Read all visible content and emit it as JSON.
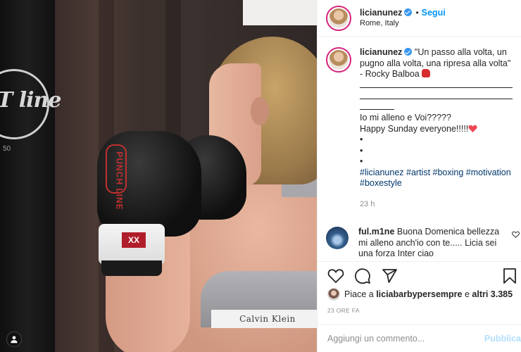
{
  "header": {
    "username": "licianunez",
    "separator": "•",
    "follow_label": "Segui",
    "location": "Rome, Italy"
  },
  "caption": {
    "username": "licianunez",
    "line1": "\"Un passo alla volta, un pugno alla volta, una ripresa alla volta\"",
    "line2": "- Rocky Balboa",
    "line3": "Io mi alleno e Voi?????",
    "line4": "Happy Sunday everyone!!!!!",
    "bullets": [
      "•",
      "•",
      "•"
    ],
    "hashtags": "#licianunez #artist #boxing #motivation #boxestyle",
    "time": "23 h"
  },
  "comment": {
    "username": "ful.m1ne",
    "text": "Buona Domenica bellezza mi alleno anch'io con te..... Licia sei una forza Inter ciao"
  },
  "likes": {
    "prefix": "Piace a",
    "user": "liciabarbypersempre",
    "middle": "e",
    "others": "altri 3.385"
  },
  "post_time": "23 ORE FA",
  "add_comment": {
    "placeholder": "Aggiungi un commento...",
    "publish_label": "Pubblica"
  },
  "photo": {
    "bag_brand": "T line",
    "bag_number": "50",
    "glove_brand": "PUNCH LINE",
    "glove_logo": "XX",
    "bra_brand": "Calvin Klein"
  },
  "colors": {
    "link": "#0095f6",
    "hashtag": "#00376b",
    "verified": "#3897f0",
    "heart": "#ed4956"
  },
  "icons": [
    "verified-icon",
    "heart-icon",
    "comment-icon",
    "share-icon",
    "bookmark-icon",
    "boxing-glove-icon"
  ]
}
